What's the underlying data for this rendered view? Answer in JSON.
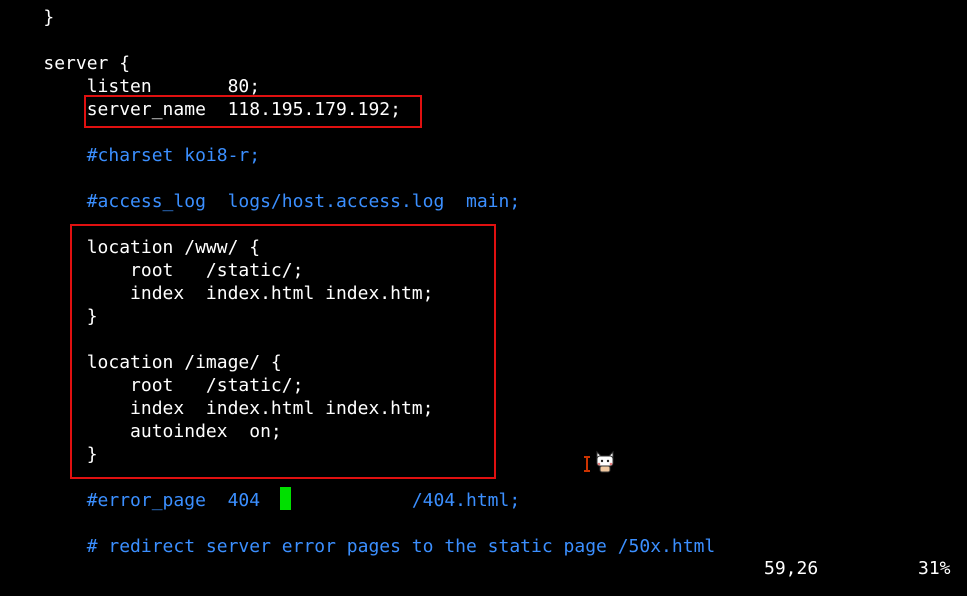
{
  "editor": {
    "lines": [
      {
        "indent": "    ",
        "text": "}",
        "kind": "plain"
      },
      {
        "indent": "",
        "text": "",
        "kind": "plain"
      },
      {
        "indent": "    ",
        "text": "server {",
        "kind": "plain"
      },
      {
        "indent": "        ",
        "text": "listen       80;",
        "kind": "plain"
      },
      {
        "indent": "        ",
        "text": "server_name  118.195.179.192;",
        "kind": "plain"
      },
      {
        "indent": "",
        "text": "",
        "kind": "plain"
      },
      {
        "indent": "        ",
        "text": "#charset koi8-r;",
        "kind": "comment"
      },
      {
        "indent": "",
        "text": "",
        "kind": "plain"
      },
      {
        "indent": "        ",
        "text": "#access_log  logs/host.access.log  main;",
        "kind": "comment"
      },
      {
        "indent": "",
        "text": "",
        "kind": "plain"
      },
      {
        "indent": "        ",
        "text": "location /www/ {",
        "kind": "plain"
      },
      {
        "indent": "            ",
        "text": "root   /static/;",
        "kind": "plain"
      },
      {
        "indent": "            ",
        "text": "index  index.html index.htm;",
        "kind": "plain"
      },
      {
        "indent": "        ",
        "text": "}",
        "kind": "plain"
      },
      {
        "indent": "",
        "text": "",
        "kind": "plain"
      },
      {
        "indent": "        ",
        "text": "location /image/ {",
        "kind": "plain"
      },
      {
        "indent": "            ",
        "text": "root   /static/;",
        "kind": "plain"
      },
      {
        "indent": "            ",
        "text": "index  index.html index.htm;",
        "kind": "plain"
      },
      {
        "indent": "            ",
        "text": "autoindex  on;",
        "kind": "plain"
      },
      {
        "indent": "        ",
        "text": "}",
        "kind": "plain"
      },
      {
        "indent": "",
        "text": "",
        "kind": "plain"
      },
      {
        "indent": "        ",
        "text": "#error_page  404 ",
        "kind": "comment",
        "after_cursor": "            /404.html;"
      },
      {
        "indent": "",
        "text": "",
        "kind": "plain"
      },
      {
        "indent": "        ",
        "text": "# redirect server error pages to the static page /50x.html",
        "kind": "comment"
      }
    ]
  },
  "status_bar": {
    "position": "59,26",
    "percent": "31%"
  },
  "colors": {
    "background": "#000000",
    "text": "#ffffff",
    "comment": "#3b8fff",
    "cursor": "#00e000",
    "highlight_box": "#e01010"
  },
  "icons": {
    "cursor_icon": "text-ibeam-icon",
    "mascot_icon": "cat-mascot-icon"
  }
}
